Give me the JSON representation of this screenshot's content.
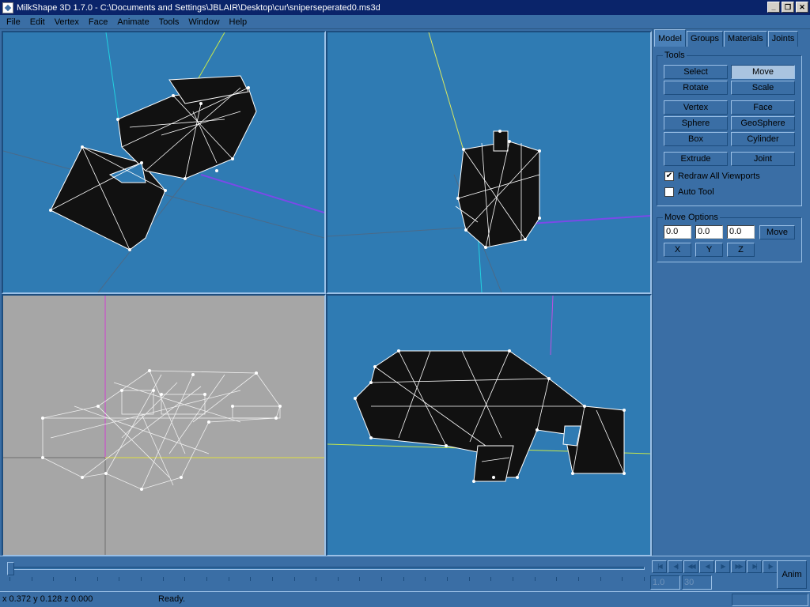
{
  "window": {
    "title": "MilkShape 3D 1.7.0 - C:\\Documents and Settings\\JBLAIR\\Desktop\\cur\\sniperseperated0.ms3d",
    "minimize_glyph": "_",
    "maximize_glyph": "❐",
    "close_glyph": "✕"
  },
  "menu": [
    "File",
    "Edit",
    "Vertex",
    "Face",
    "Animate",
    "Tools",
    "Window",
    "Help"
  ],
  "viewports": [
    {
      "view": "3d-perspective",
      "background": "#2f7bb3"
    },
    {
      "view": "3d-front",
      "background": "#2f7bb3"
    },
    {
      "view": "2d-wireframe",
      "background": "#a6a6a6"
    },
    {
      "view": "3d-side",
      "background": "#2f7bb3"
    }
  ],
  "panel": {
    "tabs": [
      "Model",
      "Groups",
      "Materials",
      "Joints"
    ],
    "active_tab": "Model",
    "tools_label": "Tools",
    "tools": {
      "select": "Select",
      "move": "Move",
      "rotate": "Rotate",
      "scale": "Scale",
      "vertex": "Vertex",
      "face": "Face",
      "sphere": "Sphere",
      "geosphere": "GeoSphere",
      "box": "Box",
      "cylinder": "Cylinder",
      "extrude": "Extrude",
      "joint": "Joint"
    },
    "active_tool": "Move",
    "redraw_all_viewports": {
      "label": "Redraw All Viewports",
      "checked": true,
      "mark": "✔"
    },
    "auto_tool": {
      "label": "Auto Tool",
      "checked": false,
      "mark": ""
    },
    "move_options": {
      "label": "Move Options",
      "x_value": "0.0",
      "y_value": "0.0",
      "z_value": "0.0",
      "move_button": "Move",
      "axis_x": "X",
      "axis_y": "Y",
      "axis_z": "Z"
    }
  },
  "timeline": {
    "nav_glyphs": [
      "|◀",
      "◀|",
      "◀◀",
      "◀",
      "▶",
      "▶▶",
      "▶|",
      "|▶"
    ],
    "current_frame": "1.0",
    "total_frames": "30",
    "anim_button": "Anim",
    "position": 0
  },
  "status": {
    "coords": "x 0.372 y 0.128 z 0.000",
    "message": "Ready."
  },
  "colors": {
    "workspace": "#3a6ea5",
    "viewport_blue": "#2f7bb3",
    "viewport_gray": "#a6a6a6",
    "titlebar": "#0a246a",
    "mesh_fill": "#111111",
    "mesh_edge": "#ffffff"
  }
}
